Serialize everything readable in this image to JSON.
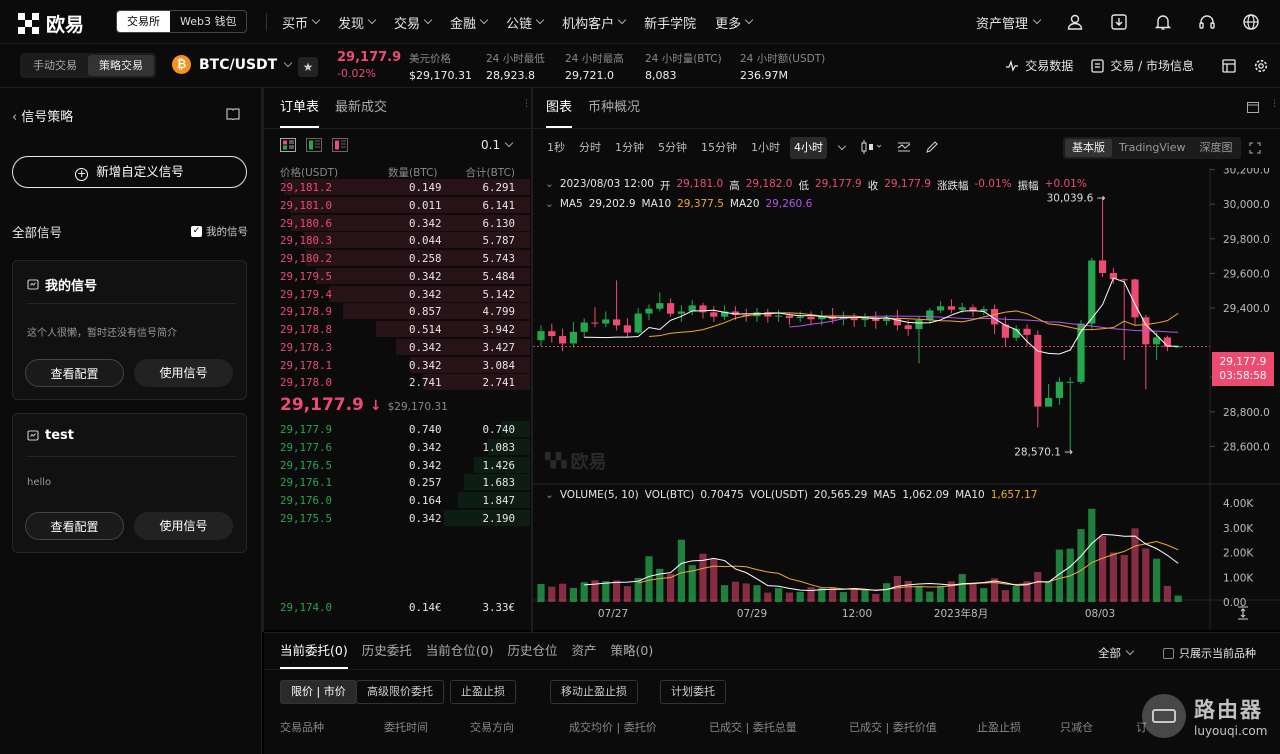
{
  "brand": {
    "name": "欧易",
    "seg": [
      "交易所",
      "Web3 钱包"
    ]
  },
  "nav": [
    "买币",
    "发现",
    "交易",
    "金融",
    "公链",
    "机构客户",
    "新手学院",
    "更多"
  ],
  "nav_carets": [
    true,
    true,
    true,
    true,
    true,
    true,
    false,
    true
  ],
  "top_right": {
    "asset": "资产管理"
  },
  "ticker": {
    "modes": [
      "手动交易",
      "策略交易"
    ],
    "pair": "BTC/USDT",
    "last": "29,177.9",
    "change": "-0.02%",
    "stats": [
      {
        "label": "美元价格",
        "value": "$29,170.31"
      },
      {
        "label": "24 小时最低",
        "value": "28,923.8"
      },
      {
        "label": "24 小时最高",
        "value": "29,721.0"
      },
      {
        "label": "24 小时量(BTC)",
        "value": "8,083"
      },
      {
        "label": "24 小时额(USDT)",
        "value": "236.97M"
      }
    ],
    "right": [
      "交易数据",
      "交易 / 市场信息"
    ]
  },
  "left": {
    "title": "信号策略",
    "add": "新增自定义信号",
    "all": "全部信号",
    "mine": "我的信号",
    "cards": [
      {
        "title": "我的信号",
        "desc": "这个人很懒，暂时还没有信号简介",
        "b1": "查看配置",
        "b2": "使用信号"
      },
      {
        "title": "test",
        "desc": "hello",
        "b1": "查看配置",
        "b2": "使用信号"
      }
    ]
  },
  "orderbook": {
    "tabs": [
      "订单表",
      "最新成交"
    ],
    "precision": "0.1",
    "headers": [
      "价格(USDT)",
      "数量(BTC)",
      "合计(BTC)"
    ],
    "asks": [
      [
        "29,181.2",
        "0.149",
        "6.291"
      ],
      [
        "29,181.0",
        "0.011",
        "6.141"
      ],
      [
        "29,180.6",
        "0.342",
        "6.130"
      ],
      [
        "29,180.3",
        "0.044",
        "5.787"
      ],
      [
        "29,180.2",
        "0.258",
        "5.743"
      ],
      [
        "29,179.5",
        "0.342",
        "5.484"
      ],
      [
        "29,179.4",
        "0.342",
        "5.142"
      ],
      [
        "29,178.9",
        "0.857",
        "4.799"
      ],
      [
        "29,178.8",
        "0.514",
        "3.942"
      ],
      [
        "29,178.3",
        "0.342",
        "3.427"
      ],
      [
        "29,178.1",
        "0.342",
        "3.084"
      ],
      [
        "29,178.0",
        "2.741",
        "2.741"
      ]
    ],
    "mid": "29,177.9",
    "mid_usd": "$29,170.31",
    "bids": [
      [
        "29,177.9",
        "0.740",
        "0.740"
      ],
      [
        "29,177.6",
        "0.342",
        "1.083"
      ],
      [
        "29,176.5",
        "0.342",
        "1.426"
      ],
      [
        "29,176.1",
        "0.257",
        "1.683"
      ],
      [
        "29,176.0",
        "0.164",
        "1.847"
      ],
      [
        "29,175.5",
        "0.342",
        "2.190"
      ]
    ],
    "last_bid": [
      "29,174.0",
      "0.14€",
      "3.33€"
    ]
  },
  "chart": {
    "tabs": [
      "图表",
      "币种概况"
    ],
    "intervals": [
      "1秒",
      "分时",
      "1分钟",
      "5分钟",
      "15分钟",
      "1小时",
      "4小时"
    ],
    "views": [
      "基本版",
      "TradingView",
      "深度图"
    ],
    "info": {
      "date": "2023/08/03 12:00",
      "open_l": "开",
      "open": "29,181.0",
      "high_l": "高",
      "high": "29,182.0",
      "low_l": "低",
      "low": "29,177.9",
      "close_l": "收",
      "close": "29,177.9",
      "chg_l": "涨跌幅",
      "chg": "-0.01%",
      "amp_l": "振幅",
      "amp": "+0.01%"
    },
    "ma": {
      "ma5_l": "MA5",
      "ma5": "29,202.9",
      "ma10_l": "MA10",
      "ma10": "29,377.5",
      "ma20_l": "MA20",
      "ma20": "29,260.6"
    },
    "max_label": "30,039.6",
    "min_label": "28,570.1",
    "cur_price": "29,177.9",
    "countdown": "03:58:58",
    "y_ticks": [
      "30,200.0",
      "30,000.0",
      "29,800.0",
      "29,600.0",
      "29,400.0",
      "29,000.0",
      "28,800.0",
      "28,600.0"
    ],
    "vol": {
      "label": "VOLUME(5, 10)",
      "vbtc_l": "VOL(BTC)",
      "vbtc": "0.70475",
      "vusdt_l": "VOL(USDT)",
      "vusdt": "20,565.29",
      "ma5_l": "MA5",
      "ma5": "1,062.09",
      "ma10_l": "MA10",
      "ma10": "1,657.17"
    },
    "vol_ticks": [
      "4.00K",
      "3.00K",
      "2.00K",
      "1.00K",
      "0.00"
    ],
    "x_ticks": [
      "07/27",
      "07/29",
      "12:00",
      "2023年8月",
      "08/03"
    ],
    "watermark": "欧易"
  },
  "bottom": {
    "tabs": [
      "当前委托(0)",
      "历史委托",
      "当前仓位(0)",
      "历史仓位",
      "资产",
      "策略(0)"
    ],
    "filter": "全部",
    "only": "只展示当前品种",
    "chips": [
      "限价 | 市价",
      "高级限价委托",
      "止盈止损",
      "移动止盈止损",
      "计划委托"
    ],
    "cols": [
      "交易品种",
      "委托时间",
      "交易方向",
      "成交均价 | 委托价",
      "已成交 | 委托总量",
      "已成交 | 委托价值",
      "止盈止损",
      "只减仓",
      "订"
    ]
  },
  "site_watermark": {
    "name": "路由器",
    "url": "luyouqi.com"
  },
  "colors": {
    "up": "#25a750",
    "down": "#ee4b73",
    "ma5": "#ffffff",
    "ma10": "#f0a830",
    "ma20": "#b455e8"
  },
  "chart_data": {
    "type": "candlestick",
    "y_range": [
      28500,
      30250
    ],
    "candles": [
      [
        29214,
        29266,
        29300,
        29180
      ],
      [
        29266,
        29238,
        29310,
        29200
      ],
      [
        29238,
        29195,
        29280,
        29150
      ],
      [
        29195,
        29262,
        29320,
        29170
      ],
      [
        29262,
        29316,
        29340,
        29230
      ],
      [
        29316,
        29310,
        29405,
        29290
      ],
      [
        29310,
        29334,
        29380,
        29290
      ],
      [
        29334,
        29300,
        29560,
        29270
      ],
      [
        29300,
        29258,
        29340,
        29230
      ],
      [
        29258,
        29368,
        29400,
        29250
      ],
      [
        29368,
        29396,
        29420,
        29330
      ],
      [
        29396,
        29428,
        29490,
        29380
      ],
      [
        29428,
        29367,
        29455,
        29350
      ],
      [
        29367,
        29380,
        29415,
        29320
      ],
      [
        29380,
        29415,
        29445,
        29360
      ],
      [
        29415,
        29375,
        29430,
        29340
      ],
      [
        29375,
        29350,
        29410,
        29320
      ],
      [
        29350,
        29380,
        29415,
        29330
      ],
      [
        29380,
        29360,
        29410,
        29330
      ],
      [
        29360,
        29352,
        29395,
        29320
      ],
      [
        29352,
        29375,
        29400,
        29320
      ],
      [
        29375,
        29350,
        29395,
        29315
      ],
      [
        29350,
        29356,
        29390,
        29320
      ],
      [
        29356,
        29342,
        29375,
        29300
      ],
      [
        29342,
        29350,
        29380,
        29320
      ],
      [
        29350,
        29335,
        29380,
        29300
      ],
      [
        29335,
        29355,
        29385,
        29300
      ],
      [
        29355,
        29335,
        29400,
        29310
      ],
      [
        29335,
        29345,
        29380,
        29300
      ],
      [
        29345,
        29330,
        29370,
        29290
      ],
      [
        29330,
        29340,
        29370,
        29290
      ],
      [
        29340,
        29325,
        29380,
        29280
      ],
      [
        29325,
        29338,
        29360,
        29300
      ],
      [
        29338,
        29300,
        29390,
        29270
      ],
      [
        29300,
        29278,
        29330,
        29240
      ],
      [
        29278,
        29330,
        29350,
        29080
      ],
      [
        29330,
        29386,
        29400,
        29310
      ],
      [
        29386,
        29410,
        29440,
        29370
      ],
      [
        29410,
        29390,
        29450,
        29370
      ],
      [
        29390,
        29404,
        29430,
        29370
      ],
      [
        29404,
        29380,
        29420,
        29350
      ],
      [
        29380,
        29394,
        29410,
        29360
      ],
      [
        29394,
        29305,
        29420,
        29250
      ],
      [
        29305,
        29228,
        29350,
        29180
      ],
      [
        29228,
        29280,
        29300,
        29210
      ],
      [
        29280,
        29245,
        29305,
        29180
      ],
      [
        29245,
        28830,
        29270,
        28710
      ],
      [
        28830,
        28880,
        28960,
        28840
      ],
      [
        28880,
        28973,
        29000,
        28840
      ],
      [
        28973,
        28973,
        29000,
        28570
      ],
      [
        28973,
        29310,
        29330,
        28960
      ],
      [
        29310,
        29675,
        29690,
        29280
      ],
      [
        29675,
        29602,
        30040,
        29580
      ],
      [
        29602,
        29566,
        29632,
        29540
      ],
      [
        29566,
        29565,
        29570,
        29100
      ],
      [
        29565,
        29346,
        29570,
        29300
      ],
      [
        29346,
        29190,
        29360,
        28930
      ],
      [
        29190,
        29230,
        29260,
        29100
      ],
      [
        29230,
        29175,
        29240,
        29150
      ],
      [
        29175,
        29178,
        29182,
        29177
      ]
    ],
    "ma5": [
      29231,
      29230,
      29229,
      29232,
      29232,
      29235,
      29287,
      29276,
      29329,
      29352,
      29383,
      29384,
      29387,
      29375,
      29365,
      29366,
      29367,
      29367,
      29371,
      29362,
      29355,
      29357,
      29351,
      29344,
      29345,
      29346,
      29344,
      29337,
      29344,
      29330,
      29317,
      29313,
      29315,
      29331,
      29359,
      29382,
      29385,
      29380,
      29338,
      29300,
      29275,
      29207,
      29151,
      29138,
      29134,
      29157,
      29264,
      29340,
      29420,
      29573,
      29551,
      29421,
      29303,
      29243,
      29180,
      29178
    ],
    "ma10": [
      29235,
      29240,
      29254,
      29260,
      29265,
      29275,
      29294,
      29315,
      29341,
      29355,
      29363,
      29373,
      29372,
      29372,
      29369,
      29362,
      29354,
      29354,
      29354,
      29353,
      29348,
      29344,
      29340,
      29340,
      29338,
      29335,
      29331,
      29326,
      29325,
      29320,
      29332,
      29349,
      29362,
      29376,
      29383,
      29367,
      29338,
      29308,
      29302,
      29288,
      29275,
      29275,
      29280,
      29287,
      29324,
      29300,
      29304,
      29313,
      29327,
      29369
    ],
    "ma20": [
      29290,
      29296,
      29306,
      29314,
      29324,
      29339,
      29346,
      29350,
      29352,
      29353,
      29353,
      29352,
      29352,
      29350,
      29347,
      29344,
      29340,
      29337,
      29340,
      29338,
      29335,
      29332,
      29330,
      29326,
      29320,
      29318,
      29310,
      29303,
      29296,
      29288,
      29280,
      29276,
      29270,
      29268,
      29266,
      29262,
      29260
    ],
    "volume": [
      730,
      620,
      740,
      570,
      800,
      880,
      840,
      870,
      640,
      970,
      1850,
      1340,
      1130,
      2520,
      1490,
      1950,
      1740,
      680,
      820,
      750,
      680,
      380,
      560,
      380,
      410,
      600,
      560,
      600,
      400,
      560,
      470,
      330,
      760,
      1050,
      850,
      650,
      420,
      650,
      840,
      1130,
      760,
      560,
      960,
      480,
      640,
      840,
      1210,
      840,
      2120,
      2160,
      2950,
      3770,
      2680,
      2000,
      1900,
      2980,
      2170,
      1750,
      650,
      260
    ]
  }
}
